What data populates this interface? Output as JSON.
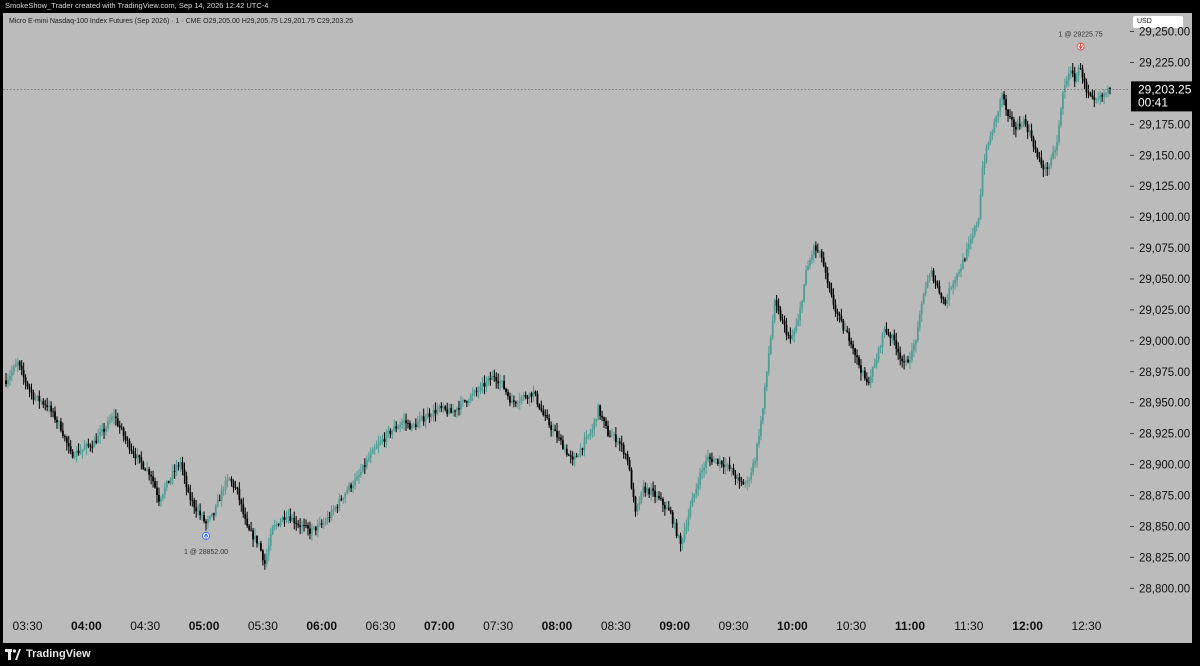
{
  "header": {
    "attribution": "SmokeShow_Trader created with TradingView.com, Sep 14, 2026 12:42 UTC-4"
  },
  "legend": {
    "symbol": "Micro E-mini Nasdaq-100 Index Futures (Sep 2026) · 1 · CME",
    "open": "O29,205.00",
    "high": "H29,205.75",
    "low": "L29,201.75",
    "close": "C29,203.25"
  },
  "currency_button": "USD",
  "footer": {
    "brand": "TradingView"
  },
  "colors": {
    "up": "#4f9d93",
    "down": "#000000",
    "background": "#bbbbbb",
    "frame": "#000000"
  },
  "chart_data": {
    "type": "candlestick",
    "title": "",
    "xlabel": "",
    "ylabel": "",
    "y_tick_labels": [
      "28,800.00",
      "28,825.00",
      "28,850.00",
      "28,875.00",
      "28,900.00",
      "28,925.00",
      "28,950.00",
      "28,975.00",
      "29,000.00",
      "29,025.00",
      "29,050.00",
      "29,075.00",
      "29,100.00",
      "29,125.00",
      "29,150.00",
      "29,175.00",
      "29,225.00",
      "29,250.00"
    ],
    "y_tick_values": [
      28800,
      28825,
      28850,
      28875,
      28900,
      28925,
      28950,
      28975,
      29000,
      29025,
      29050,
      29075,
      29100,
      29125,
      29150,
      29175,
      29225,
      29250
    ],
    "x_tick_labels": [
      {
        "label": "03:30",
        "bold": false
      },
      {
        "label": "04:00",
        "bold": true
      },
      {
        "label": "04:30",
        "bold": false
      },
      {
        "label": "05:00",
        "bold": true
      },
      {
        "label": "05:30",
        "bold": false
      },
      {
        "label": "06:00",
        "bold": true
      },
      {
        "label": "06:30",
        "bold": false
      },
      {
        "label": "07:00",
        "bold": true
      },
      {
        "label": "07:30",
        "bold": false
      },
      {
        "label": "08:00",
        "bold": true
      },
      {
        "label": "08:30",
        "bold": false
      },
      {
        "label": "09:00",
        "bold": true
      },
      {
        "label": "09:30",
        "bold": false
      },
      {
        "label": "10:00",
        "bold": true
      },
      {
        "label": "10:30",
        "bold": false
      },
      {
        "label": "11:00",
        "bold": true
      },
      {
        "label": "11:30",
        "bold": false
      },
      {
        "label": "12:00",
        "bold": true
      },
      {
        "label": "12:30",
        "bold": false
      }
    ],
    "x_range": [
      "03:19",
      "12:42"
    ],
    "y_range": [
      28780,
      29265
    ],
    "interval_minutes": 1,
    "last_price": 29203.25,
    "last_price_label": "29,203.25",
    "countdown": "00:41",
    "path_points": [
      [
        "03:19",
        28968
      ],
      [
        "03:25",
        28982
      ],
      [
        "03:28",
        28970
      ],
      [
        "03:33",
        28955
      ],
      [
        "03:40",
        28948
      ],
      [
        "03:47",
        28930
      ],
      [
        "03:52",
        28908
      ],
      [
        "03:58",
        28912
      ],
      [
        "04:04",
        28918
      ],
      [
        "04:10",
        28930
      ],
      [
        "04:14",
        28940
      ],
      [
        "04:20",
        28920
      ],
      [
        "04:26",
        28905
      ],
      [
        "04:33",
        28892
      ],
      [
        "04:37",
        28872
      ],
      [
        "04:45",
        28895
      ],
      [
        "04:48",
        28902
      ],
      [
        "04:52",
        28875
      ],
      [
        "04:57",
        28862
      ],
      [
        "05:01",
        28852
      ],
      [
        "05:05",
        28860
      ],
      [
        "05:10",
        28882
      ],
      [
        "05:13",
        28888
      ],
      [
        "05:17",
        28878
      ],
      [
        "05:22",
        28848
      ],
      [
        "05:28",
        28836
      ],
      [
        "05:31",
        28820
      ],
      [
        "05:35",
        28848
      ],
      [
        "05:42",
        28860
      ],
      [
        "05:48",
        28852
      ],
      [
        "05:54",
        28846
      ],
      [
        "06:01",
        28852
      ],
      [
        "06:07",
        28865
      ],
      [
        "06:13",
        28880
      ],
      [
        "06:18",
        28888
      ],
      [
        "06:24",
        28905
      ],
      [
        "06:30",
        28918
      ],
      [
        "06:36",
        28928
      ],
      [
        "06:42",
        28935
      ],
      [
        "06:46",
        28930
      ],
      [
        "06:54",
        28940
      ],
      [
        "07:00",
        28945
      ],
      [
        "07:06",
        28942
      ],
      [
        "07:12",
        28950
      ],
      [
        "07:20",
        28960
      ],
      [
        "07:28",
        28972
      ],
      [
        "07:32",
        28965
      ],
      [
        "07:37",
        28950
      ],
      [
        "07:43",
        28955
      ],
      [
        "07:48",
        28958
      ],
      [
        "07:53",
        28940
      ],
      [
        "07:57",
        28930
      ],
      [
        "08:02",
        28918
      ],
      [
        "08:08",
        28902
      ],
      [
        "08:13",
        28915
      ],
      [
        "08:18",
        28928
      ],
      [
        "08:21",
        28945
      ],
      [
        "08:26",
        28925
      ],
      [
        "08:31",
        28920
      ],
      [
        "08:36",
        28905
      ],
      [
        "08:40",
        28860
      ],
      [
        "08:44",
        28880
      ],
      [
        "08:48",
        28878
      ],
      [
        "08:53",
        28870
      ],
      [
        "08:58",
        28860
      ],
      [
        "09:03",
        28835
      ],
      [
        "09:08",
        28865
      ],
      [
        "09:13",
        28892
      ],
      [
        "09:17",
        28905
      ],
      [
        "09:24",
        28902
      ],
      [
        "09:29",
        28895
      ],
      [
        "09:33",
        28885
      ],
      [
        "09:37",
        28885
      ],
      [
        "09:41",
        28905
      ],
      [
        "09:45",
        28945
      ],
      [
        "09:48",
        28990
      ],
      [
        "09:51",
        29030
      ],
      [
        "09:55",
        29015
      ],
      [
        "09:59",
        29000
      ],
      [
        "10:03",
        29015
      ],
      [
        "10:07",
        29055
      ],
      [
        "10:11",
        29075
      ],
      [
        "10:15",
        29068
      ],
      [
        "10:18",
        29045
      ],
      [
        "10:22",
        29025
      ],
      [
        "10:26",
        29010
      ],
      [
        "10:30",
        29000
      ],
      [
        "10:33",
        28985
      ],
      [
        "10:38",
        28965
      ],
      [
        "10:42",
        28980
      ],
      [
        "10:47",
        29010
      ],
      [
        "10:52",
        29000
      ],
      [
        "10:57",
        28980
      ],
      [
        "11:01",
        28990
      ],
      [
        "11:04",
        29008
      ],
      [
        "11:07",
        29040
      ],
      [
        "11:11",
        29055
      ],
      [
        "11:15",
        29040
      ],
      [
        "11:18",
        29030
      ],
      [
        "11:21",
        29045
      ],
      [
        "11:26",
        29060
      ],
      [
        "11:31",
        29080
      ],
      [
        "11:35",
        29100
      ],
      [
        "11:37",
        29140
      ],
      [
        "11:40",
        29160
      ],
      [
        "11:44",
        29180
      ],
      [
        "11:47",
        29200
      ],
      [
        "11:50",
        29180
      ],
      [
        "11:54",
        29172
      ],
      [
        "11:58",
        29178
      ],
      [
        "12:02",
        29165
      ],
      [
        "12:05",
        29148
      ],
      [
        "12:09",
        29138
      ],
      [
        "12:12",
        29145
      ],
      [
        "12:15",
        29160
      ],
      [
        "12:18",
        29200
      ],
      [
        "12:21",
        29218
      ],
      [
        "12:24",
        29212
      ],
      [
        "12:27",
        29222
      ],
      [
        "12:30",
        29200
      ],
      [
        "12:34",
        29192
      ],
      [
        "12:37",
        29196
      ],
      [
        "12:42",
        29203
      ]
    ],
    "annotations": [
      {
        "label": "1 @ 28852.00",
        "time": "05:01",
        "price": 28852,
        "side": "buy"
      },
      {
        "label": "1 @ 29225.75",
        "time": "12:27",
        "price": 29225.75,
        "side": "sell"
      }
    ]
  }
}
